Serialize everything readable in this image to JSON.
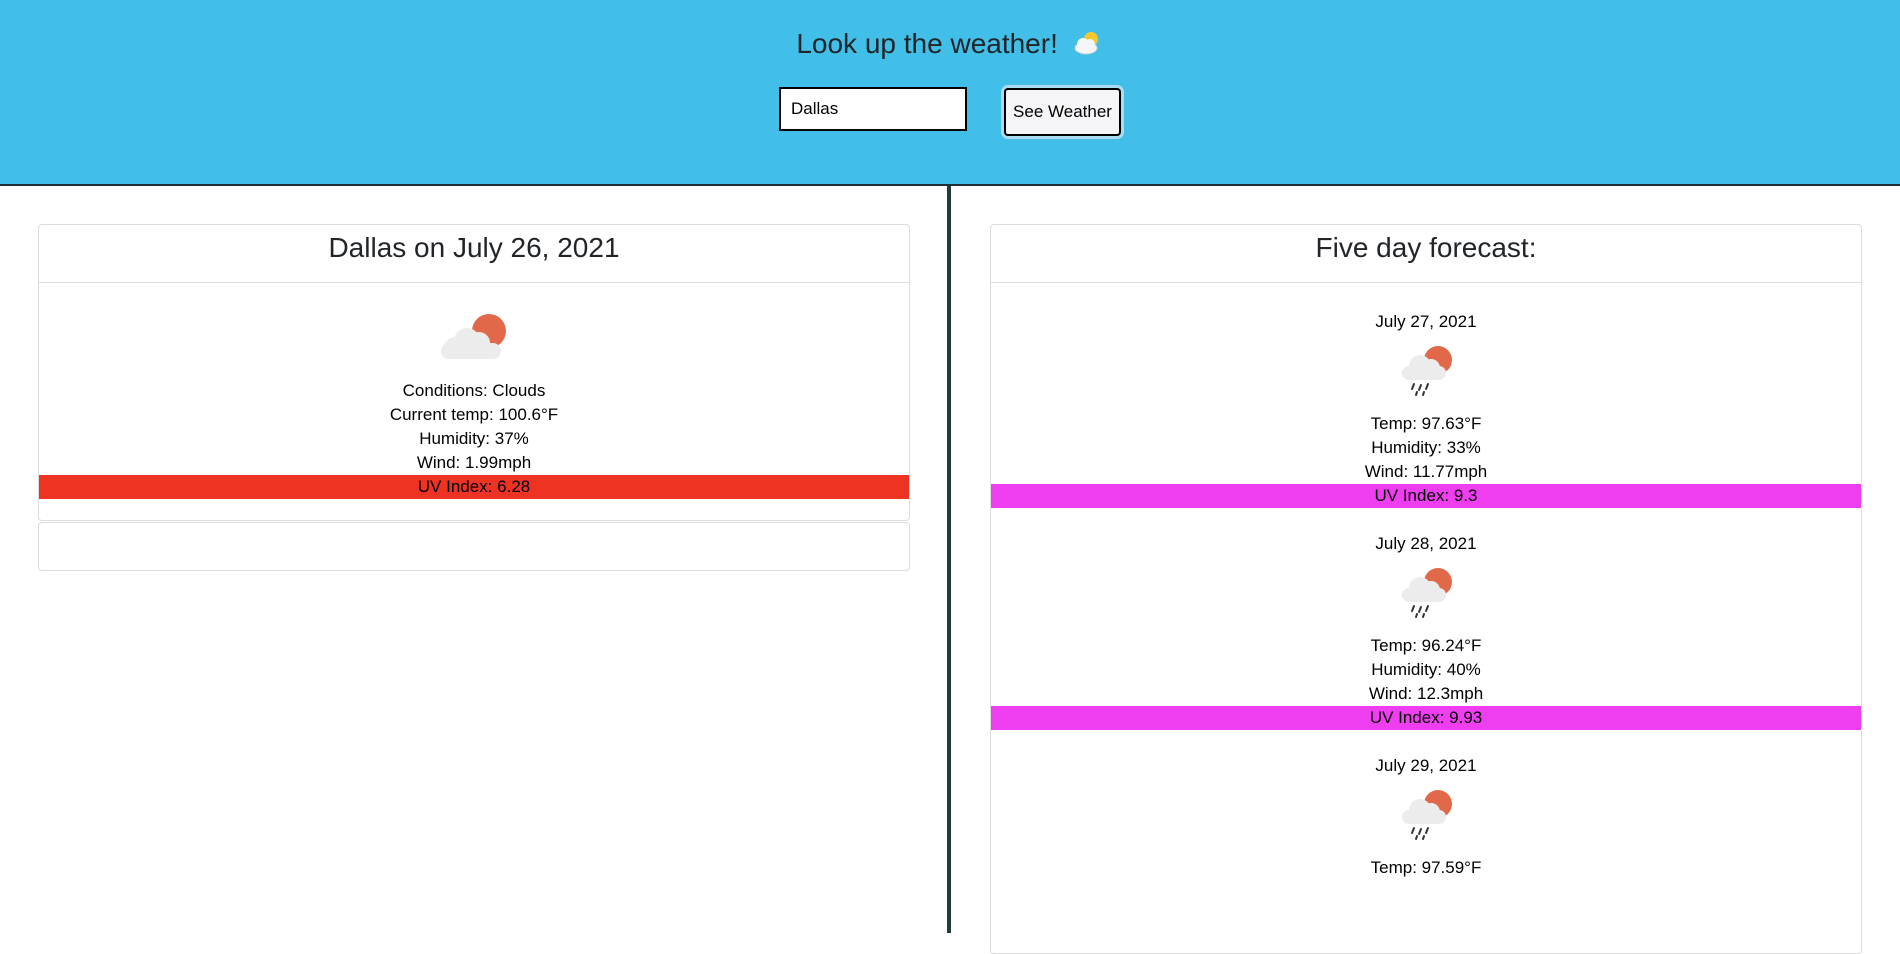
{
  "header": {
    "title": "Look up the weather!",
    "search_value": "Dallas",
    "button_label": "See Weather",
    "background": "#41bfe8"
  },
  "current": {
    "heading": "Dallas on July 26, 2021",
    "icon": "cloud-sun-icon",
    "conditions": "Conditions: Clouds",
    "temp": "Current temp: 100.6°F",
    "humidity": "Humidity: 37%",
    "wind": "Wind: 1.99mph",
    "uv": "UV Index: 6.28",
    "uv_color": "#ee3322"
  },
  "forecast": {
    "heading": "Five day forecast:",
    "days": [
      {
        "date": "July 27, 2021",
        "icon": "rain-sun-icon",
        "temp": "Temp: 97.63°F",
        "humidity": "Humidity: 33%",
        "wind": "Wind: 11.77mph",
        "uv": "UV Index: 9.3",
        "uv_color": "#ee3ef0"
      },
      {
        "date": "July 28, 2021",
        "icon": "rain-sun-icon",
        "temp": "Temp: 96.24°F",
        "humidity": "Humidity: 40%",
        "wind": "Wind: 12.3mph",
        "uv": "UV Index: 9.93",
        "uv_color": "#ee3ef0"
      },
      {
        "date": "July 29, 2021",
        "icon": "rain-sun-icon",
        "temp": "Temp: 97.59°F"
      }
    ]
  }
}
